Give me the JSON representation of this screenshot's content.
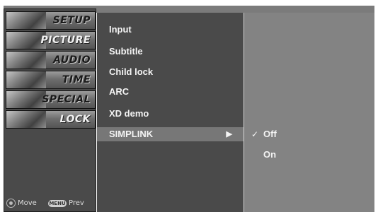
{
  "sidebar": {
    "tabs": [
      {
        "label": "SETUP",
        "icon": "setup-icon"
      },
      {
        "label": "PICTURE",
        "icon": "picture-icon"
      },
      {
        "label": "AUDIO",
        "icon": "audio-icon"
      },
      {
        "label": "TIME",
        "icon": "time-icon"
      },
      {
        "label": "SPECIAL",
        "icon": "special-icon"
      },
      {
        "label": "LOCK",
        "icon": "lock-icon"
      }
    ],
    "hint": {
      "move_label": "Move",
      "menu_key_label": "MENU",
      "prev_label": "Prev"
    }
  },
  "submenu": {
    "items": [
      {
        "label": "Input"
      },
      {
        "label": "Subtitle"
      },
      {
        "label": "Child lock"
      },
      {
        "label": "ARC"
      },
      {
        "label": "XD demo"
      },
      {
        "label": "SIMPLINK",
        "selected": true
      }
    ],
    "submenu_arrow": "▶"
  },
  "options": {
    "items": [
      {
        "label": "Off",
        "checked": true
      },
      {
        "label": "On",
        "checked": false
      }
    ],
    "check_mark": "✓"
  },
  "colors": {
    "panel_dark": "#4a4a4a",
    "panel_light": "#838383",
    "selection": "#777777",
    "text": "#f4f4f4"
  }
}
